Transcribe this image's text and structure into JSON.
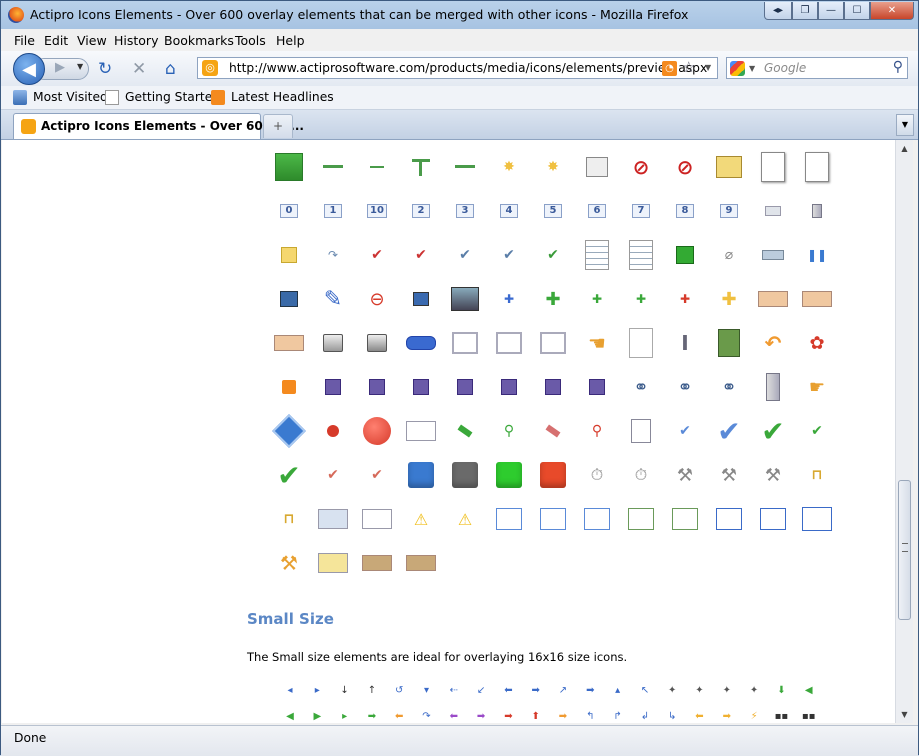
{
  "window": {
    "title": "Actipro Icons Elements - Over 600 overlay elements that can be merged with other icons - Mozilla Firefox"
  },
  "menu": [
    "File",
    "Edit",
    "View",
    "History",
    "Bookmarks",
    "Tools",
    "Help"
  ],
  "nav": {
    "url": "http://www.actiprosoftware.com/products/media/icons/elements/preview.aspx",
    "search_placeholder": "Google"
  },
  "bookmarks": [
    "Most Visited",
    "Getting Started",
    "Latest Headlines"
  ],
  "tab": {
    "label": "Actipro Icons Elements - Over 600 ov...",
    "new_tab": "+"
  },
  "page": {
    "heading": "Small Size",
    "description": "The Small size elements are ideal for overlaying 16x16 size icons.",
    "number_icons": [
      "0",
      "1",
      "10",
      "2",
      "3",
      "4",
      "5",
      "6",
      "7",
      "8",
      "9"
    ]
  },
  "status": "Done",
  "colors": {
    "accent": "#5b87c5",
    "titlebar": "#b9d1ea",
    "close": "#c8452a"
  }
}
